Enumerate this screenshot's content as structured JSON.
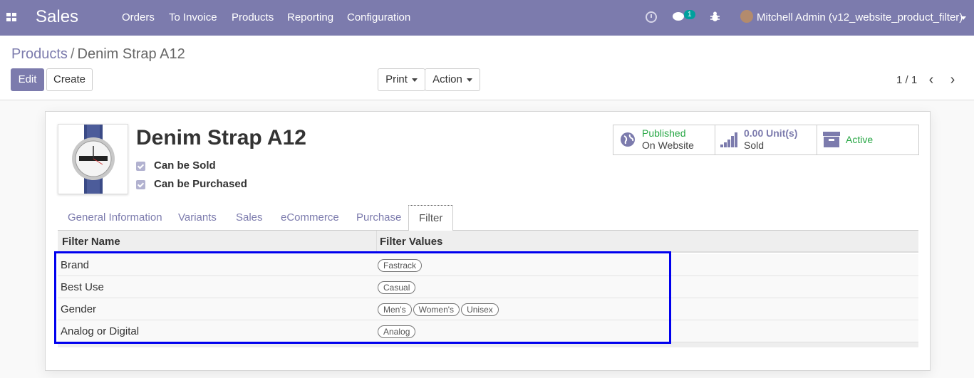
{
  "navbar": {
    "app_name": "Sales",
    "menu": [
      "Orders",
      "To Invoice",
      "Products",
      "Reporting",
      "Configuration"
    ],
    "chat_badge": "1",
    "user": "Mitchell Admin (v12_website_product_filter)",
    "icons": [
      "apps-icon",
      "clock-icon",
      "chat-icon",
      "bug-icon",
      "avatar"
    ]
  },
  "breadcrumb": {
    "parent": "Products",
    "separator": "/",
    "current": "Denim Strap A12"
  },
  "toolbar": {
    "edit": "Edit",
    "create": "Create",
    "print": "Print",
    "action": "Action"
  },
  "pager": {
    "value": "1 / 1"
  },
  "product": {
    "name": "Denim Strap A12",
    "can_be_sold_label": "Can be Sold",
    "can_be_purchased_label": "Can be Purchased",
    "can_be_sold": true,
    "can_be_purchased": true
  },
  "stat_buttons": [
    {
      "line1": "Published",
      "line2": "On Website",
      "icon": "globe-icon"
    },
    {
      "line1": "0.00 Unit(s)",
      "line2": "Sold",
      "icon": "bar-chart-icon"
    },
    {
      "line1": "Active",
      "line2": "",
      "icon": "archive-icon"
    }
  ],
  "tabs": [
    "General Information",
    "Variants",
    "Sales",
    "eCommerce",
    "Purchase",
    "Filter"
  ],
  "active_tab": "Filter",
  "filter_table": {
    "headers": [
      "Filter Name",
      "Filter Values"
    ],
    "rows": [
      {
        "name": "Brand",
        "values": [
          "Fastrack"
        ]
      },
      {
        "name": "Best Use",
        "values": [
          "Casual"
        ]
      },
      {
        "name": "Gender",
        "values": [
          "Men's",
          "Women's",
          "Unisex"
        ]
      },
      {
        "name": "Analog or Digital",
        "values": [
          "Analog"
        ]
      }
    ]
  },
  "colors": {
    "brand": "#7c7bad",
    "published": "#28a745",
    "highlight": "#0000ee",
    "badge": "#00a09d"
  }
}
